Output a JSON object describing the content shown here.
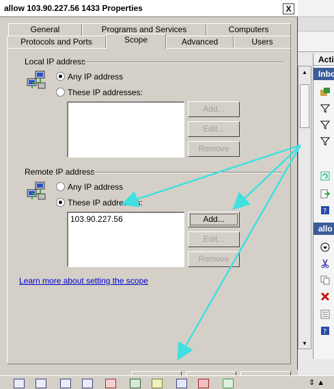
{
  "window": {
    "title": "allow 103.90.227.56 1433 Properties",
    "close_label": "X"
  },
  "tabs": {
    "row1": [
      "General",
      "Programs and Services",
      "Computers"
    ],
    "row2": [
      "Protocols and Ports",
      "Scope",
      "Advanced",
      "Users"
    ],
    "active": "Scope"
  },
  "local": {
    "label": "Local IP address",
    "any_label": "Any IP address",
    "these_label": "These IP addresses:",
    "selected": "any",
    "entries": [],
    "add_label": "Add...",
    "edit_label": "Edit...",
    "remove_label": "Remove"
  },
  "remote": {
    "label": "Remote IP address",
    "any_label": "Any IP address",
    "these_label": "These IP addresses:",
    "selected": "these",
    "entries": [
      "103.90.227.56"
    ],
    "add_label": "Add...",
    "edit_label": "Edit...",
    "remove_label": "Remove"
  },
  "learn_more": "Learn more about setting the scope",
  "background": {
    "actions_title": "Acti",
    "inbound_title": "Inbo",
    "allow_title": "allo"
  },
  "colors": {
    "annotation_arrows": "#3ee0e0",
    "pane_header": "#3c5c99",
    "link": "#0000cc"
  }
}
